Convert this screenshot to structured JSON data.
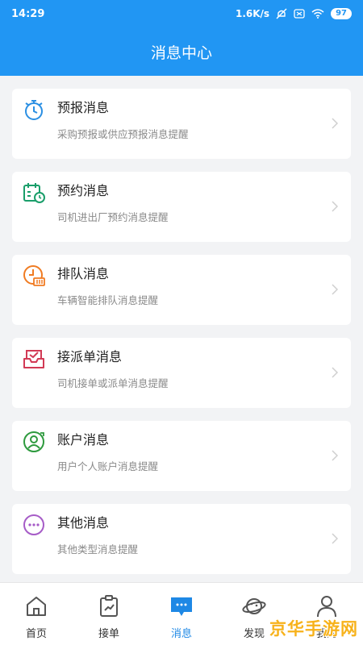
{
  "status": {
    "time": "14:29",
    "speed": "1.6K/s",
    "battery": "97"
  },
  "header": {
    "title": "消息中心"
  },
  "messages": [
    {
      "title": "预报消息",
      "subtitle": "采购预报或供应预报消息提醒",
      "icon": "stopwatch-icon",
      "color": "#2b8fe3"
    },
    {
      "title": "预约消息",
      "subtitle": "司机进出厂预约消息提醒",
      "icon": "calendar-clock-icon",
      "color": "#1a9e6a"
    },
    {
      "title": "排队消息",
      "subtitle": "车辆智能排队消息提醒",
      "icon": "queue-clock-icon",
      "color": "#f07b22"
    },
    {
      "title": "接派单消息",
      "subtitle": "司机接单或派单消息提醒",
      "icon": "inbox-check-icon",
      "color": "#d23a55"
    },
    {
      "title": "账户消息",
      "subtitle": "用户个人账户消息提醒",
      "icon": "account-icon",
      "color": "#2e9a3e"
    },
    {
      "title": "其他消息",
      "subtitle": "其他类型消息提醒",
      "icon": "more-dots-icon",
      "color": "#a65cc7"
    }
  ],
  "tabs": [
    {
      "label": "首页",
      "icon": "home-icon"
    },
    {
      "label": "接单",
      "icon": "order-icon"
    },
    {
      "label": "消息",
      "icon": "message-icon",
      "active": true
    },
    {
      "label": "发现",
      "icon": "planet-icon"
    },
    {
      "label": "我的",
      "icon": "user-icon"
    }
  ],
  "watermark": "京华手游网",
  "colors": {
    "primary": "#2196f3",
    "active_tab": "#1e88e5",
    "watermark": "#f7b21b"
  }
}
